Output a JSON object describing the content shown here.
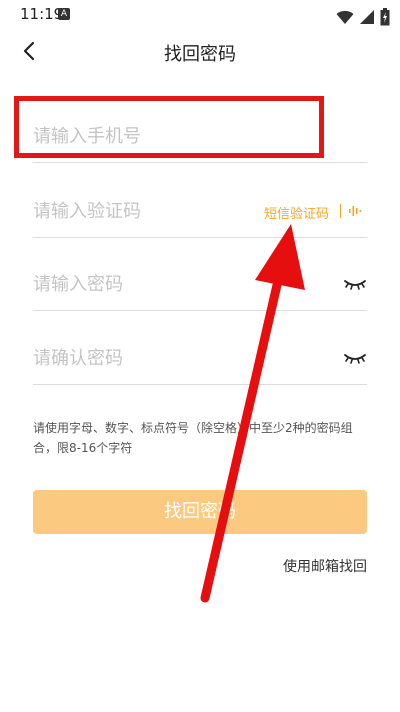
{
  "status_bar": {
    "time": "11:19",
    "notification": "A"
  },
  "header": {
    "title": "找回密码",
    "back_icon": "chevron-left-icon"
  },
  "form": {
    "phone_placeholder": "请输入手机号",
    "code_placeholder": "请输入验证码",
    "sms_code_label": "短信验证码",
    "password_placeholder": "请输入密码",
    "confirm_placeholder": "请确认密码",
    "hint": "请使用字母、数字、标点符号（除空格）中至少2种的密码组合，限8-16个字符",
    "submit_label": "找回密码",
    "email_link": "使用邮箱找回"
  },
  "colors": {
    "accent": "#f5a623",
    "button_bg": "#fbc97f",
    "annotation": "#e01818"
  }
}
